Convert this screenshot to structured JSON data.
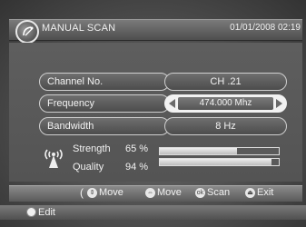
{
  "header": {
    "title": "MANUAL SCAN",
    "datetime": "01/01/2008 02:19"
  },
  "rows": [
    {
      "label": "Channel No.",
      "value": "CH .21"
    },
    {
      "label": "Frequency",
      "value": "474.000 Mhz"
    },
    {
      "label": "Bandwidth",
      "value": "8 Hz"
    }
  ],
  "signal": {
    "strength_label": "Strength",
    "strength_value": "65 %",
    "strength_level": 0.65,
    "quality_label": "Quality",
    "quality_value": "94 %",
    "quality_level": 0.94
  },
  "help": {
    "open_paren": "(",
    "move1": "Move",
    "move2": "Move",
    "ok_icon": "ok",
    "scan": "Scan",
    "exit": "Exit"
  },
  "edit": {
    "label": "Edit"
  },
  "icons": {
    "logo": "satellite-dish-icon",
    "signal": "antenna-signal-icon",
    "updown": "up-down-arrows-icon",
    "leftright": "left-right-arrows-icon",
    "ok": "ok-button-icon",
    "exit": "exit-button-icon"
  }
}
